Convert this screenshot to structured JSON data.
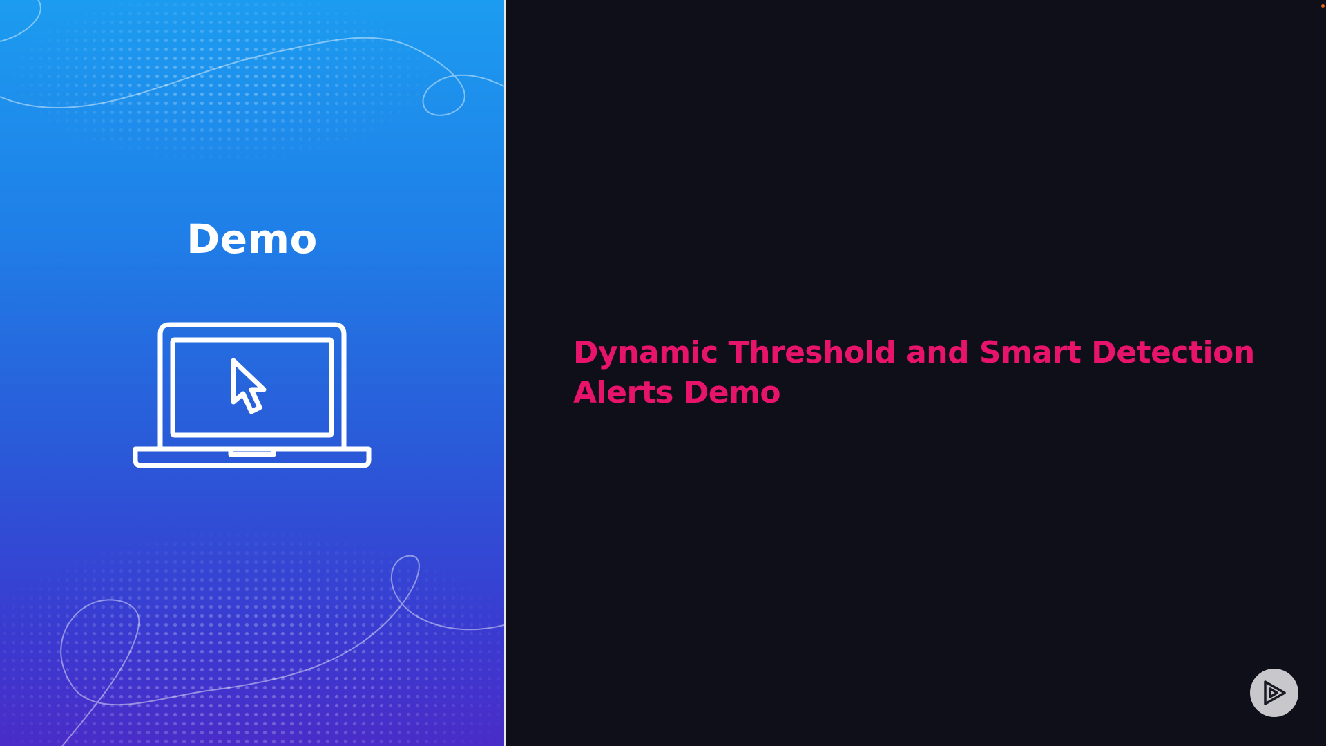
{
  "left_panel": {
    "title": "Demo",
    "icon": "laptop-cursor-icon"
  },
  "main": {
    "headline_line1": "Dynamic Threshold and Smart Detection",
    "headline_line2": "Alerts Demo"
  },
  "controls": {
    "play_icon": "play-logo-icon"
  },
  "colors": {
    "accent": "#e8146c",
    "background": "#0f0f1a",
    "gradient_top": "#1c9cf0",
    "gradient_bottom": "#4a2cc8"
  }
}
